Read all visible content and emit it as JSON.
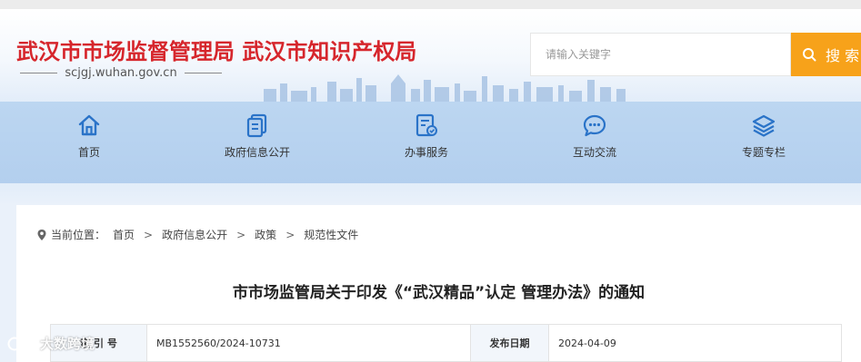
{
  "colors": {
    "brand_red": "#d6262c",
    "search_orange": "#f7a21a",
    "nav_bg": "#b3cfee",
    "icon_blue": "#2a73c8"
  },
  "header": {
    "site_title": "武汉市市场监督管理局 武汉市知识产权局",
    "domain": "scjgj.wuhan.gov.cn"
  },
  "search": {
    "placeholder": "请输入关键字",
    "button_label": "搜 索",
    "icon": "search-icon"
  },
  "nav": {
    "items": [
      {
        "label": "首页",
        "icon": "home-icon"
      },
      {
        "label": "政府信息公开",
        "icon": "document-icon"
      },
      {
        "label": "办事服务",
        "icon": "service-icon"
      },
      {
        "label": "互动交流",
        "icon": "chat-icon"
      },
      {
        "label": "专题专栏",
        "icon": "layers-icon"
      }
    ]
  },
  "breadcrumb": {
    "prefix": "当前位置：",
    "items": [
      "首页",
      "政府信息公开",
      "政策",
      "规范性文件"
    ]
  },
  "article": {
    "title": "市市场监管局关于印发《“武汉精品”认定 管理办法》的通知",
    "meta": {
      "index_label": "索 引 号",
      "index_value": "MB1552560/2024-10731",
      "date_label": "发布日期",
      "date_value": "2024-04-09"
    }
  },
  "watermark": {
    "text": "大数跨境"
  }
}
